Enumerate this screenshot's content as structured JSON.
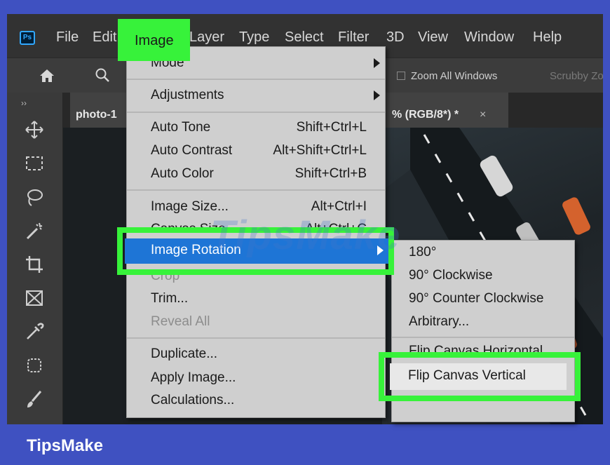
{
  "menubar": {
    "items": [
      "File",
      "Edit",
      "Image",
      "Layer",
      "Type",
      "Select",
      "Filter",
      "3D",
      "View",
      "Window",
      "Help"
    ]
  },
  "options_bar": {
    "zoom_all_windows": "Zoom All Windows",
    "scrubby_zoom": "Scrubby Zo"
  },
  "tabs": {
    "left_title": "photo-1",
    "right_title": "% (RGB/8*) *",
    "close_glyph": "×"
  },
  "image_menu": {
    "mode": "Mode",
    "adjustments": "Adjustments",
    "auto_tone": "Auto Tone",
    "auto_tone_shortcut": "Shift+Ctrl+L",
    "auto_contrast": "Auto Contrast",
    "auto_contrast_shortcut": "Alt+Shift+Ctrl+L",
    "auto_color": "Auto Color",
    "auto_color_shortcut": "Shift+Ctrl+B",
    "image_size": "Image Size...",
    "image_size_shortcut": "Alt+Ctrl+I",
    "canvas_size": "Canvas Size...",
    "canvas_size_shortcut": "Alt+Ctrl+C",
    "image_rotation": "Image Rotation",
    "crop": "Crop",
    "trim": "Trim...",
    "reveal_all": "Reveal All",
    "duplicate": "Duplicate...",
    "apply_image": "Apply Image...",
    "calculations": "Calculations..."
  },
  "rotation_submenu": {
    "r180": "180°",
    "cw90": "90° Clockwise",
    "ccw90": "90° Counter Clockwise",
    "arbitrary": "Arbitrary...",
    "flip_horizontal": "Flip Canvas Horizontal",
    "flip_vertical": "Flip Canvas Vertical"
  },
  "watermark": "TipsMake",
  "footer": {
    "brand": "TipsMake"
  },
  "colors": {
    "highlight": "#37f23a",
    "selection": "#1e75d6",
    "frame": "#3f51c1",
    "menu_bg": "#cfcfcf"
  }
}
